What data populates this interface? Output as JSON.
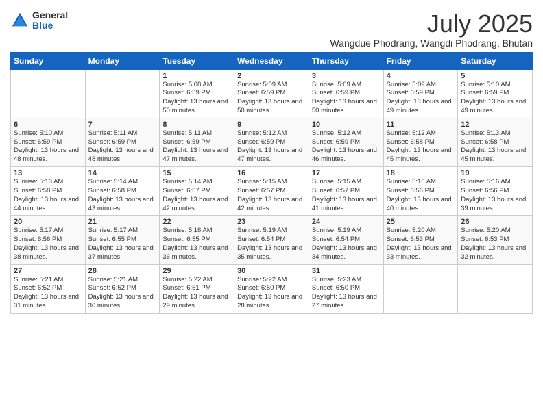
{
  "header": {
    "logo_general": "General",
    "logo_blue": "Blue",
    "month_year": "July 2025",
    "location": "Wangdue Phodrang, Wangdi Phodrang, Bhutan"
  },
  "days_of_week": [
    "Sunday",
    "Monday",
    "Tuesday",
    "Wednesday",
    "Thursday",
    "Friday",
    "Saturday"
  ],
  "weeks": [
    [
      {
        "num": "",
        "info": ""
      },
      {
        "num": "",
        "info": ""
      },
      {
        "num": "1",
        "info": "Sunrise: 5:08 AM\nSunset: 6:59 PM\nDaylight: 13 hours and 50 minutes."
      },
      {
        "num": "2",
        "info": "Sunrise: 5:09 AM\nSunset: 6:59 PM\nDaylight: 13 hours and 50 minutes."
      },
      {
        "num": "3",
        "info": "Sunrise: 5:09 AM\nSunset: 6:59 PM\nDaylight: 13 hours and 50 minutes."
      },
      {
        "num": "4",
        "info": "Sunrise: 5:09 AM\nSunset: 6:59 PM\nDaylight: 13 hours and 49 minutes."
      },
      {
        "num": "5",
        "info": "Sunrise: 5:10 AM\nSunset: 6:59 PM\nDaylight: 13 hours and 49 minutes."
      }
    ],
    [
      {
        "num": "6",
        "info": "Sunrise: 5:10 AM\nSunset: 6:59 PM\nDaylight: 13 hours and 48 minutes."
      },
      {
        "num": "7",
        "info": "Sunrise: 5:11 AM\nSunset: 6:59 PM\nDaylight: 13 hours and 48 minutes."
      },
      {
        "num": "8",
        "info": "Sunrise: 5:11 AM\nSunset: 6:59 PM\nDaylight: 13 hours and 47 minutes."
      },
      {
        "num": "9",
        "info": "Sunrise: 5:12 AM\nSunset: 6:59 PM\nDaylight: 13 hours and 47 minutes."
      },
      {
        "num": "10",
        "info": "Sunrise: 5:12 AM\nSunset: 6:59 PM\nDaylight: 13 hours and 46 minutes."
      },
      {
        "num": "11",
        "info": "Sunrise: 5:12 AM\nSunset: 6:58 PM\nDaylight: 13 hours and 45 minutes."
      },
      {
        "num": "12",
        "info": "Sunrise: 5:13 AM\nSunset: 6:58 PM\nDaylight: 13 hours and 45 minutes."
      }
    ],
    [
      {
        "num": "13",
        "info": "Sunrise: 5:13 AM\nSunset: 6:58 PM\nDaylight: 13 hours and 44 minutes."
      },
      {
        "num": "14",
        "info": "Sunrise: 5:14 AM\nSunset: 6:58 PM\nDaylight: 13 hours and 43 minutes."
      },
      {
        "num": "15",
        "info": "Sunrise: 5:14 AM\nSunset: 6:57 PM\nDaylight: 13 hours and 42 minutes."
      },
      {
        "num": "16",
        "info": "Sunrise: 5:15 AM\nSunset: 6:57 PM\nDaylight: 13 hours and 42 minutes."
      },
      {
        "num": "17",
        "info": "Sunrise: 5:15 AM\nSunset: 6:57 PM\nDaylight: 13 hours and 41 minutes."
      },
      {
        "num": "18",
        "info": "Sunrise: 5:16 AM\nSunset: 6:56 PM\nDaylight: 13 hours and 40 minutes."
      },
      {
        "num": "19",
        "info": "Sunrise: 5:16 AM\nSunset: 6:56 PM\nDaylight: 13 hours and 39 minutes."
      }
    ],
    [
      {
        "num": "20",
        "info": "Sunrise: 5:17 AM\nSunset: 6:56 PM\nDaylight: 13 hours and 38 minutes."
      },
      {
        "num": "21",
        "info": "Sunrise: 5:17 AM\nSunset: 6:55 PM\nDaylight: 13 hours and 37 minutes."
      },
      {
        "num": "22",
        "info": "Sunrise: 5:18 AM\nSunset: 6:55 PM\nDaylight: 13 hours and 36 minutes."
      },
      {
        "num": "23",
        "info": "Sunrise: 5:19 AM\nSunset: 6:54 PM\nDaylight: 13 hours and 35 minutes."
      },
      {
        "num": "24",
        "info": "Sunrise: 5:19 AM\nSunset: 6:54 PM\nDaylight: 13 hours and 34 minutes."
      },
      {
        "num": "25",
        "info": "Sunrise: 5:20 AM\nSunset: 6:53 PM\nDaylight: 13 hours and 33 minutes."
      },
      {
        "num": "26",
        "info": "Sunrise: 5:20 AM\nSunset: 6:53 PM\nDaylight: 13 hours and 32 minutes."
      }
    ],
    [
      {
        "num": "27",
        "info": "Sunrise: 5:21 AM\nSunset: 6:52 PM\nDaylight: 13 hours and 31 minutes."
      },
      {
        "num": "28",
        "info": "Sunrise: 5:21 AM\nSunset: 6:52 PM\nDaylight: 13 hours and 30 minutes."
      },
      {
        "num": "29",
        "info": "Sunrise: 5:22 AM\nSunset: 6:51 PM\nDaylight: 13 hours and 29 minutes."
      },
      {
        "num": "30",
        "info": "Sunrise: 5:22 AM\nSunset: 6:50 PM\nDaylight: 13 hours and 28 minutes."
      },
      {
        "num": "31",
        "info": "Sunrise: 5:23 AM\nSunset: 6:50 PM\nDaylight: 13 hours and 27 minutes."
      },
      {
        "num": "",
        "info": ""
      },
      {
        "num": "",
        "info": ""
      }
    ]
  ]
}
